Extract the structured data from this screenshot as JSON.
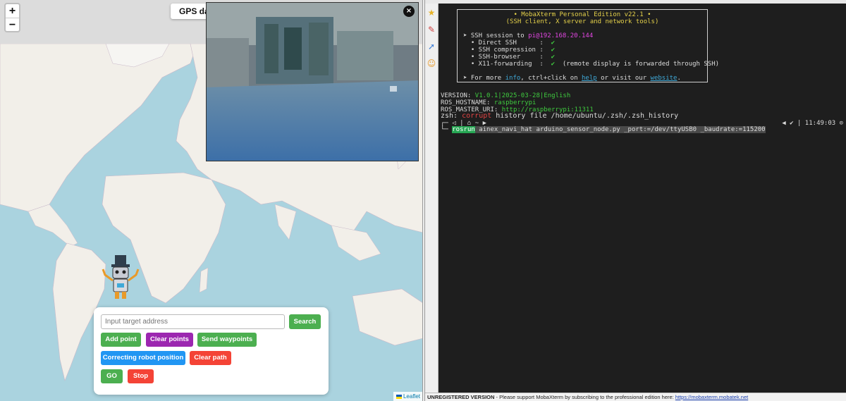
{
  "map": {
    "zoom_in": "+",
    "zoom_out": "−",
    "gps_button": "GPS data",
    "video_close": "×",
    "address_placeholder": "Input target address",
    "buttons": {
      "search": "Search",
      "add_point": "Add point",
      "clear_points": "Clear points",
      "send_waypoints": "Send waypoints",
      "correct_position": "Correcting robot position",
      "clear_path": "Clear path",
      "go": "GO",
      "stop": "Stop"
    },
    "attribution": "Leaflet",
    "colors": {
      "green": "#4caf50",
      "purple": "#9c27b0",
      "blue": "#2196f3",
      "red": "#f44336"
    }
  },
  "terminal": {
    "title": "• MobaXterm Personal Edition v22.1 •",
    "subtitle": "(SSH client, X server and network tools)",
    "ssh_prefix": "➤ SSH session to ",
    "ssh_host": "pi@192.168.20.144",
    "features": [
      {
        "label": "  • Direct SSH      :  ",
        "check": "✔",
        "note": ""
      },
      {
        "label": "  • SSH compression :  ",
        "check": "✔",
        "note": ""
      },
      {
        "label": "  • SSH-browser     :  ",
        "check": "✔",
        "note": ""
      },
      {
        "label": "  • X11-forwarding  :  ",
        "check": "✔",
        "note": "  (remote display is forwarded through SSH)"
      }
    ],
    "info_prefix": "➤ For more ",
    "info_word": "info",
    "info_mid": ", ctrl+click on ",
    "help_word": "help",
    "info_mid2": " or visit our ",
    "website_word": "website",
    "info_end": ".",
    "version_label": "VERSION: ",
    "version_value": "V1.0.1|2025-03-28|English",
    "hostname_label": "ROS_HOSTNAME: ",
    "hostname_value": "raspberrypi",
    "master_label": "ROS_MASTER_URI: ",
    "master_value": "http://raspberrypi:11311",
    "zsh_prefix": "zsh: ",
    "zsh_corrupt": "corrupt",
    "zsh_rest": " history file /home/ubuntu/.zsh/.zsh_history",
    "prompt_top": "┌─ ◁ | ⌂ ~ ▶",
    "prompt_bottom": "└─",
    "cmd_rosrun": "rosrun",
    "cmd_rest": " ainex_navi_hat arduino_sensor_node.py _port:=/dev/ttyUSB0 _baudrate:=115200",
    "clock": "◀ ✔ | 11:49:03 ⊙",
    "status_bold": "UNREGISTERED VERSION",
    "status_text": "  -  Please support MobaXterm by subscribing to the professional edition here:  ",
    "status_link": "https://mobaxterm.mobatek.net"
  }
}
